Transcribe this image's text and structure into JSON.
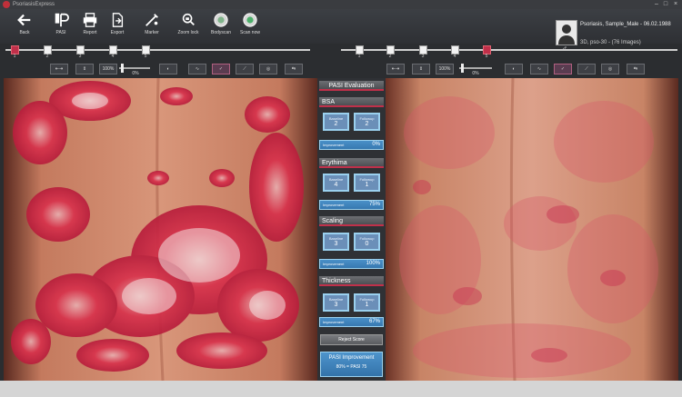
{
  "window": {
    "title": "PsoriasisExpress"
  },
  "toolbar": {
    "buttons": [
      {
        "label": "Back",
        "icon": "back-arrow-icon"
      },
      {
        "label": "PASI",
        "icon": "pasi-icon"
      },
      {
        "label": "Report",
        "icon": "printer-icon"
      },
      {
        "label": "Export",
        "icon": "export-icon"
      },
      {
        "label": "Marker",
        "icon": "marker-icon"
      },
      {
        "label": "Zoom lock",
        "icon": "zoom-lock-icon"
      },
      {
        "label": "Bodyscan",
        "icon": "bodyscan-icon"
      },
      {
        "label": "Scan now",
        "icon": "scan-now-icon"
      }
    ]
  },
  "patient": {
    "name": "Psoriasis, Sample_Male - 06.02.1988",
    "subtitle": "3D, pso-30 - (76 Images)",
    "gender_symbol": "♂"
  },
  "timeline_left": {
    "items": [
      "1",
      "2",
      "3",
      "4",
      "5"
    ],
    "active": 0
  },
  "timeline_right": {
    "items": [
      "1",
      "2",
      "3",
      "4",
      "5"
    ],
    "active": 4
  },
  "view_tools_left": {
    "zoom": "100%",
    "brightness": "0%"
  },
  "view_tools_right": {
    "zoom": "100%",
    "brightness": "0%"
  },
  "pasi": {
    "title": "PASI Evaluation",
    "sections": [
      {
        "name": "BSA",
        "baseline_label": "Baseline",
        "baseline": "2",
        "followup_label": "Followup",
        "followup": "2",
        "improvement_label": "Improvement",
        "improvement": "0%"
      },
      {
        "name": "Erythima",
        "baseline_label": "Baseline",
        "baseline": "4",
        "followup_label": "Followup",
        "followup": "1",
        "improvement_label": "Improvement",
        "improvement": "75%"
      },
      {
        "name": "Scaling",
        "baseline_label": "Baseline",
        "baseline": "3",
        "followup_label": "Followup",
        "followup": "0",
        "improvement_label": "Improvement",
        "improvement": "100%"
      },
      {
        "name": "Thickness",
        "baseline_label": "Baseline",
        "baseline": "3",
        "followup_label": "Followup",
        "followup": "1",
        "improvement_label": "Improvement",
        "improvement": "67%"
      }
    ],
    "reject_label": "Reject Score",
    "final_title": "PASI Improvement",
    "final_value": "80% = PASI 75"
  },
  "colors": {
    "accent": "#c0304a",
    "panel_blue": "#3f86c0",
    "toolbar": "#34373b"
  }
}
